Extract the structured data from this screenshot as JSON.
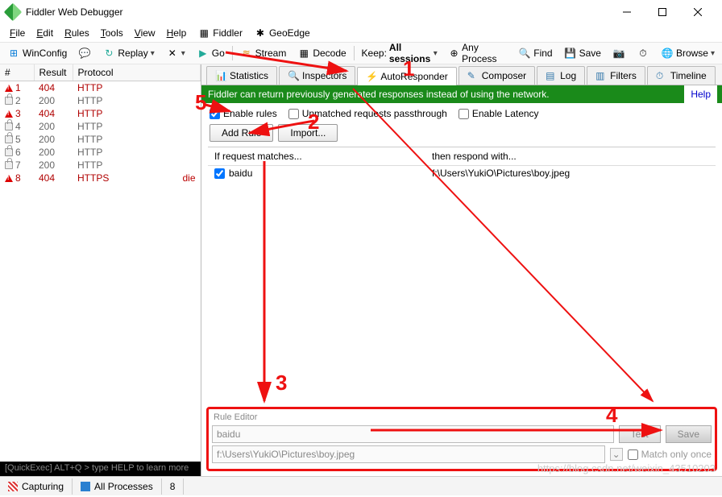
{
  "window": {
    "title": "Fiddler Web Debugger"
  },
  "menu": {
    "items": [
      "File",
      "Edit",
      "Rules",
      "Tools",
      "View",
      "Help",
      "Fiddler",
      "GeoEdge"
    ]
  },
  "toolbar": {
    "winconfig": "WinConfig",
    "replay": "Replay",
    "go": "Go",
    "stream": "Stream",
    "decode": "Decode",
    "keep_label": "Keep:",
    "keep_value": "All sessions",
    "anyprocess": "Any Process",
    "find": "Find",
    "save": "Save",
    "browse": "Browse"
  },
  "grid": {
    "cols": [
      "#",
      "Result",
      "Protocol"
    ],
    "rows": [
      {
        "id": "1",
        "result": "404",
        "proto": "HTTP",
        "err": true
      },
      {
        "id": "2",
        "result": "200",
        "proto": "HTTP",
        "err": false
      },
      {
        "id": "3",
        "result": "404",
        "proto": "HTTP",
        "err": true
      },
      {
        "id": "4",
        "result": "200",
        "proto": "HTTP",
        "err": false
      },
      {
        "id": "5",
        "result": "200",
        "proto": "HTTP",
        "err": false
      },
      {
        "id": "6",
        "result": "200",
        "proto": "HTTP",
        "err": false
      },
      {
        "id": "7",
        "result": "200",
        "proto": "HTTP",
        "err": false
      },
      {
        "id": "8",
        "result": "404",
        "proto": "HTTPS",
        "err": true,
        "extra": "die"
      }
    ]
  },
  "quickexec": "[QuickExec] ALT+Q > type HELP to learn more",
  "rtabs": {
    "items": [
      "Statistics",
      "Inspectors",
      "AutoResponder",
      "Composer",
      "Log",
      "Filters",
      "Timeline"
    ],
    "active": 2
  },
  "banner": {
    "text": "Fiddler can return previously generated responses instead of using the network.",
    "help": "Help"
  },
  "opts": {
    "enable": "Enable rules",
    "passthrough": "Unmatched requests passthrough",
    "latency": "Enable Latency"
  },
  "btns": {
    "add": "Add Rule",
    "import": "Import..."
  },
  "rules": {
    "h1": "If request matches...",
    "h2": "then respond with...",
    "rows": [
      {
        "match": "baidu",
        "respond": "f:\\Users\\YukiO\\Pictures\\boy.jpeg"
      }
    ]
  },
  "editor": {
    "title": "Rule Editor",
    "match": "baidu",
    "respond": "f:\\Users\\YukiO\\Pictures\\boy.jpeg",
    "test": "Test",
    "save": "Save",
    "matchonce": "Match only once"
  },
  "status": {
    "capturing": "Capturing",
    "allprocs": "All Processes",
    "count": "8"
  },
  "annotations": {
    "a1": "1",
    "a2": "2",
    "a3": "3",
    "a4": "4",
    "a5": "5"
  },
  "watermark": "https://blog.csdn.net/weixin_43510203"
}
